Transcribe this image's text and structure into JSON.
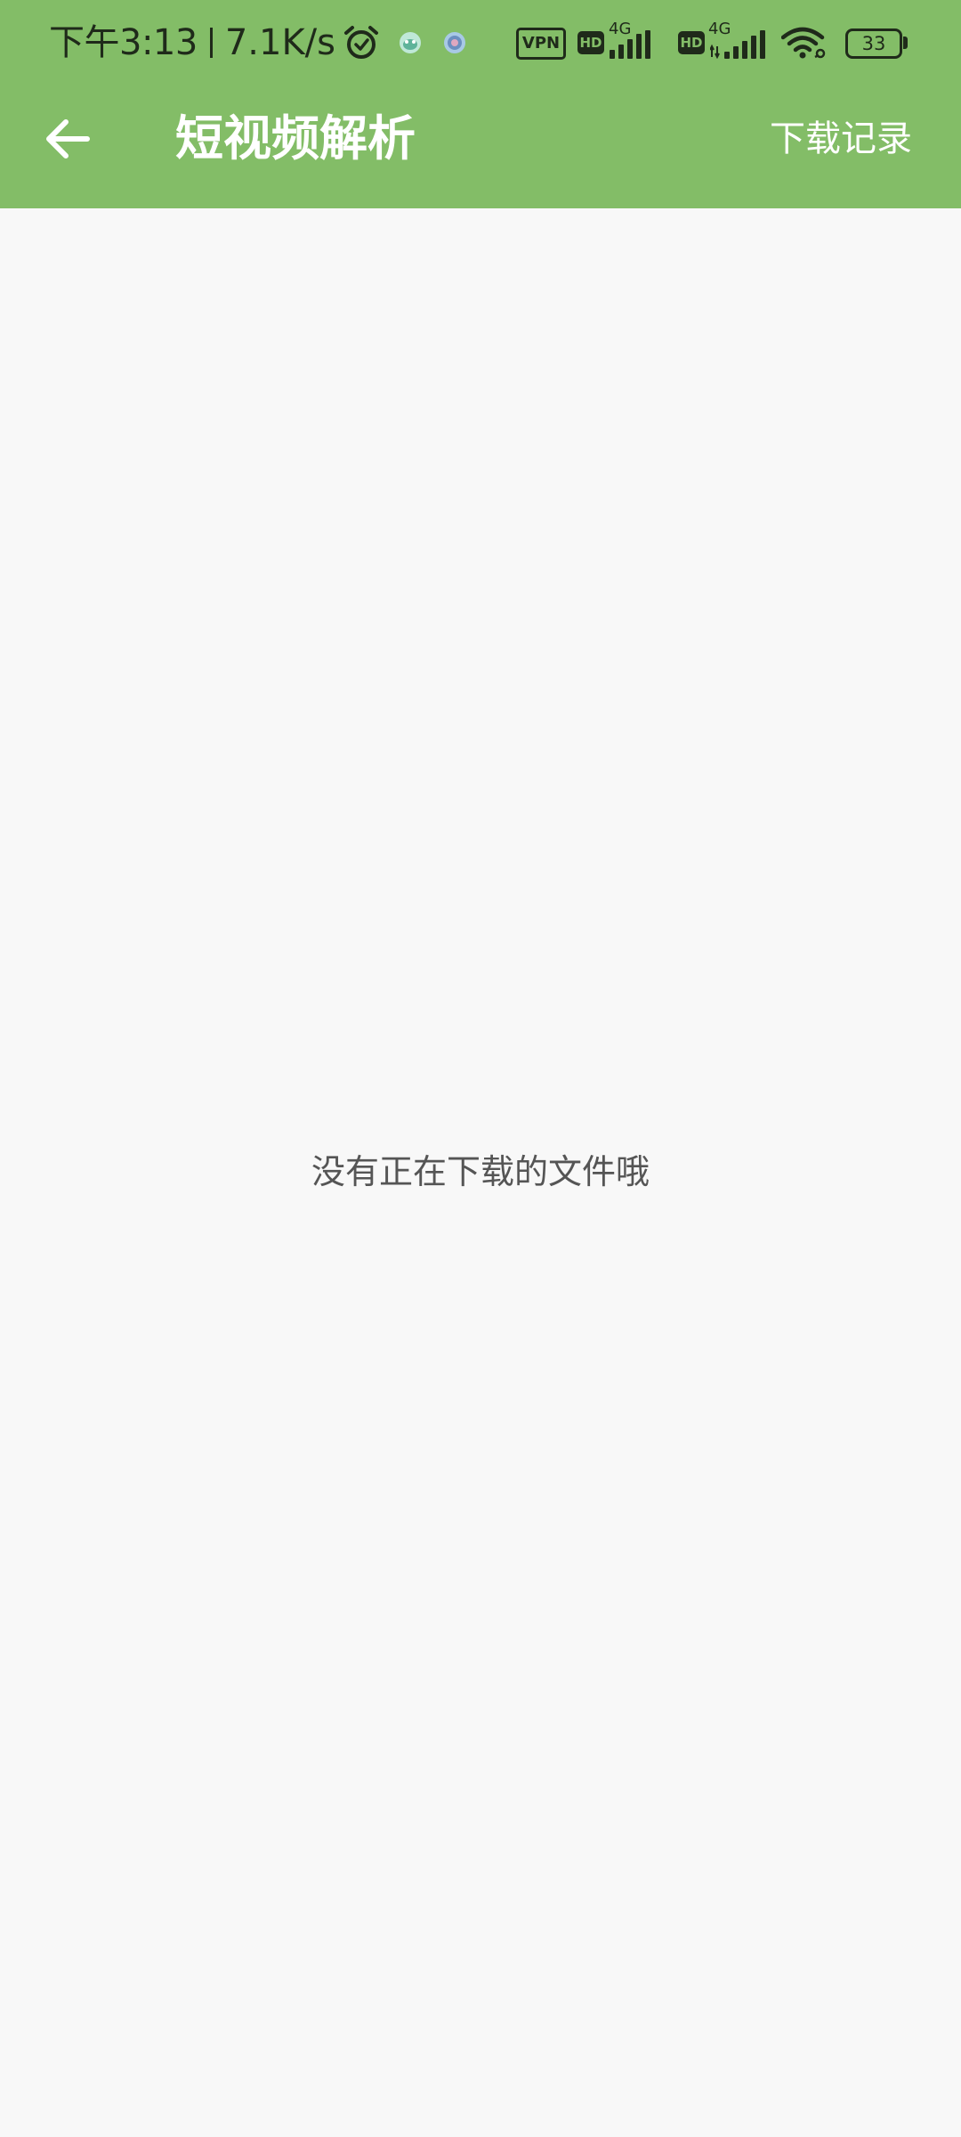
{
  "status_bar": {
    "time": "下午3:13",
    "net_speed": "7.1K/s",
    "vpn_label": "VPN",
    "hd1_label": "HD",
    "net1_label": "4G",
    "hd2_label": "HD",
    "net2_label": "4G",
    "battery_level": "33",
    "icons": [
      "alarm-icon",
      "app-notification-icon",
      "app-notification-icon",
      "vpn-icon",
      "hd-icon",
      "signal-icon",
      "hd-icon",
      "signal-icon",
      "wifi-icon",
      "battery-icon"
    ]
  },
  "app_bar": {
    "back_icon": "arrow-left-icon",
    "title": "短视频解析",
    "action_label": "下载记录"
  },
  "content": {
    "empty_message": "没有正在下载的文件哦"
  },
  "colors": {
    "header_bg": "#83bd67",
    "page_bg": "#f8f8f8",
    "text_on_header": "#ffffff",
    "message_text": "#555555"
  }
}
